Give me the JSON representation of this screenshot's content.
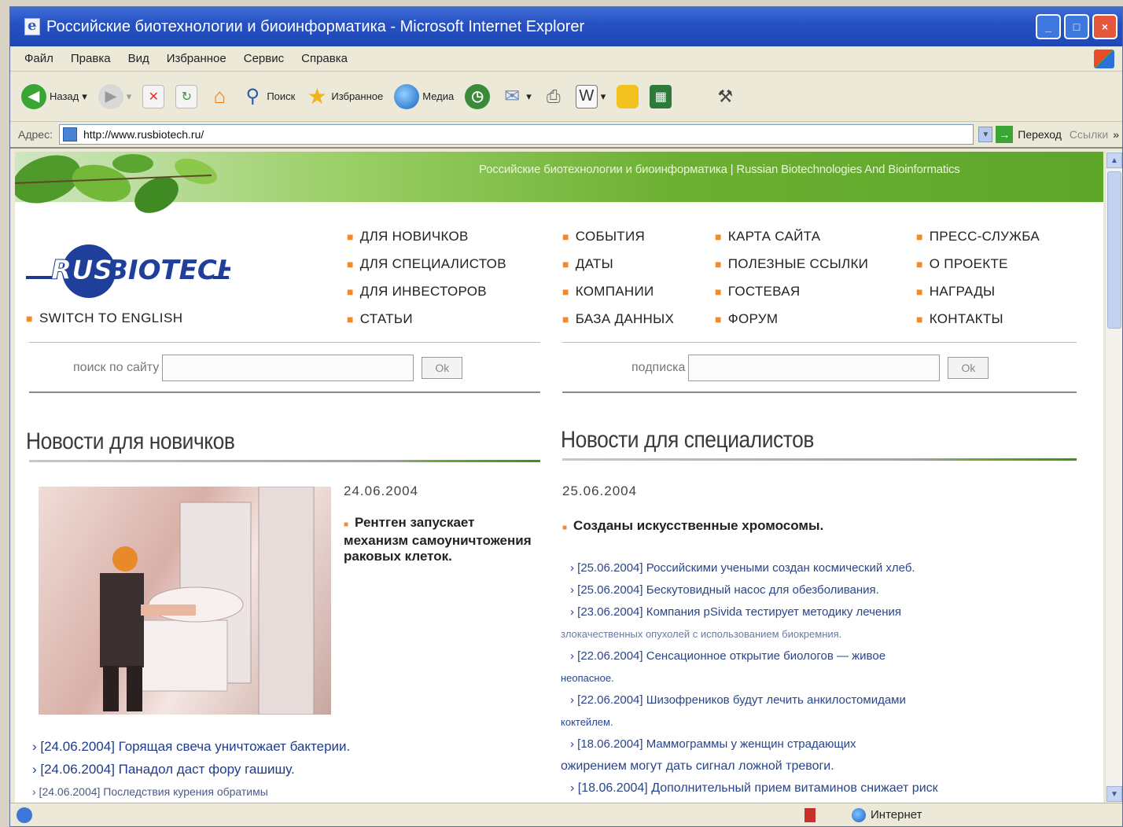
{
  "window": {
    "title": "Российские биотехнологии и биоинформатика - Microsoft Internet Explorer",
    "controls": {
      "minimize": "_",
      "maximize": "□",
      "close": "×"
    }
  },
  "menu": [
    "Файл",
    "Правка",
    "Вид",
    "Избранное",
    "Сервис",
    "Справка"
  ],
  "toolbar": {
    "back": "Назад",
    "search": "Поиск",
    "favorites": "Избранное",
    "media": "Медиа"
  },
  "address": {
    "label": "Адрес:",
    "url": "http://www.rusbiotech.ru/",
    "go": "Переход",
    "links": "Ссылки",
    "more": "»"
  },
  "site": {
    "banner_text": "Российские биотехнологии и биоинформатика | Russian Biotechnologies And Bioinformatics",
    "logo": "RUSBIOTECH",
    "switch": "SWITCH TO ENGLISH",
    "nav_col1": [
      "ДЛЯ НОВИЧКОВ",
      "ДЛЯ СПЕЦИАЛИСТОВ",
      "ДЛЯ ИНВЕСТОРОВ",
      "СТАТЬИ"
    ],
    "nav_col2": [
      "СОБЫТИЯ",
      "ДАТЫ",
      "КОМПАНИИ",
      "БАЗА ДАННЫХ"
    ],
    "nav_col3": [
      "КАРТА САЙТА",
      "ПОЛЕЗНЫЕ ССЫЛКИ",
      "ГОСТЕВАЯ",
      "ФОРУМ"
    ],
    "nav_col4": [
      "ПРЕСС-СЛУЖБА",
      "О ПРОЕКТЕ",
      "НАГРАДЫ",
      "КОНТАКТЫ"
    ],
    "search_label": "поиск по сайту",
    "subscribe_label": "подписка",
    "ok": "Ok"
  },
  "news_beginners": {
    "title": "Новости для новичков",
    "date": "24.06.2004",
    "headline": "Рентген запускает механизм самоуничтожения раковых клеток.",
    "items": [
      "› [24.06.2004] Горящая свеча уничтожает бактерии.",
      "› [24.06.2004] Панадол даст фору гашишу.",
      "› [24.06.2004] Последствия курения обратимы"
    ]
  },
  "news_specialists": {
    "title": "Новости для специалистов",
    "date": "25.06.2004",
    "headline": "Созданы искусственные хромосомы.",
    "items": [
      "› [25.06.2004] Российскими учеными создан космический хлеб.",
      "› [25.06.2004] Бескутовидный насос для обезболивания.",
      "› [23.06.2004] Компания pSivida тестирует методику лечения",
      "злокачественных опухолей с использованием биокремния.",
      "› [22.06.2004] Сенсационное открытие биологов — живое",
      "неопасное.",
      "› [22.06.2004] Шизофреников будут лечить анкилостомидами",
      "коктейлем.",
      "› [18.06.2004] Маммограммы у женщин страдающих",
      "ожирением могут дать сигнал ложной тревоги.",
      "› [18.06.2004] Дополнительный прием витаминов снижает риск"
    ]
  },
  "status": {
    "zone": "Интернет"
  },
  "colors": {
    "title_bar": "#2752c4",
    "banner_green": "#6db033",
    "bullet_orange": "#f28a2a",
    "link_blue": "#1e3c8a"
  }
}
